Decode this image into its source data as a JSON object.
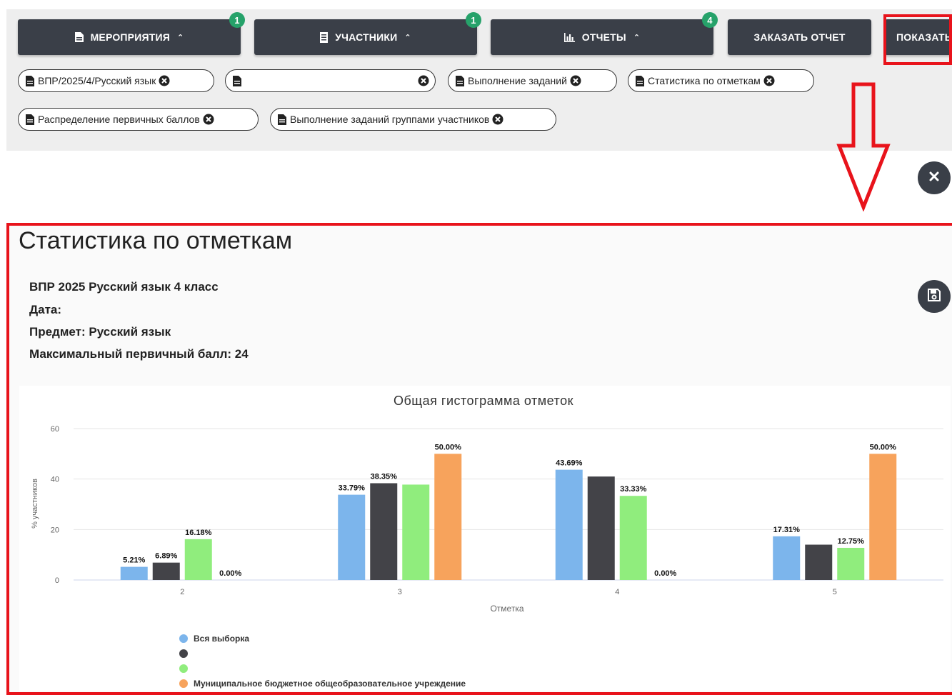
{
  "toolbar": {
    "events": {
      "label": "Мероприятия",
      "badge": "1"
    },
    "participants": {
      "label": "Участники",
      "badge": "1"
    },
    "reports": {
      "label": "Отчеты",
      "badge": "4"
    },
    "order_report": {
      "label": "Заказать отчет"
    },
    "show": {
      "label": "Показать"
    }
  },
  "chips": [
    {
      "label": "ВПР/2025/4/Русский язык"
    },
    {
      "label": ""
    },
    {
      "label": "Выполнение заданий"
    },
    {
      "label": "Статистика по отметкам"
    },
    {
      "label": "Распределение первичных баллов"
    },
    {
      "label": "Выполнение заданий группами участников"
    }
  ],
  "icons": {
    "doc": "document-icon",
    "close_chip": "close-circle-icon",
    "close": "close-icon",
    "save": "save-icon",
    "chart": "bar-chart-icon",
    "caret": "caret-up-icon"
  },
  "report": {
    "title": "Статистика по отметкам",
    "line1": "ВПР 2025 Русский язык 4 класс",
    "line2": "Дата:",
    "line3": "Предмет: Русский язык",
    "line4": "Максимальный первичный балл: 24"
  },
  "colors": {
    "accent_dark": "#3a3f48",
    "badge_green": "#26a26a",
    "annotation_red": "#e8131b",
    "series": [
      "#7cb5ec",
      "#434348",
      "#90ed7d",
      "#f7a35c"
    ]
  },
  "chart_data": {
    "type": "bar",
    "title": "Общая гистограмма отметок",
    "xlabel": "Отметка",
    "ylabel": "% участников",
    "categories": [
      "2",
      "3",
      "4",
      "5"
    ],
    "ylim": [
      0,
      60
    ],
    "yticks": [
      0,
      20,
      40,
      60
    ],
    "grid": true,
    "legend_position": "bottom-left",
    "series": [
      {
        "name": "Вся выборка",
        "values": [
          5.21,
          33.79,
          43.69,
          17.31
        ],
        "labels": [
          "5.21%",
          "33.79%",
          "43.69%",
          "17.31%"
        ]
      },
      {
        "name": "",
        "values": [
          6.89,
          38.35,
          41.0,
          14.0
        ],
        "labels": [
          "6.89%",
          "38.35%",
          "",
          ""
        ]
      },
      {
        "name": "",
        "values": [
          16.18,
          37.8,
          33.33,
          12.75
        ],
        "labels": [
          "16.18%",
          "",
          "33.33%",
          "12.75%"
        ]
      },
      {
        "name": "Муниципальное бюджетное общеобразовательное учреждение",
        "values": [
          0.0,
          50.0,
          0.0,
          50.0
        ],
        "labels": [
          "0.00%",
          "50.00%",
          "0.00%",
          "50.00%"
        ]
      }
    ]
  }
}
